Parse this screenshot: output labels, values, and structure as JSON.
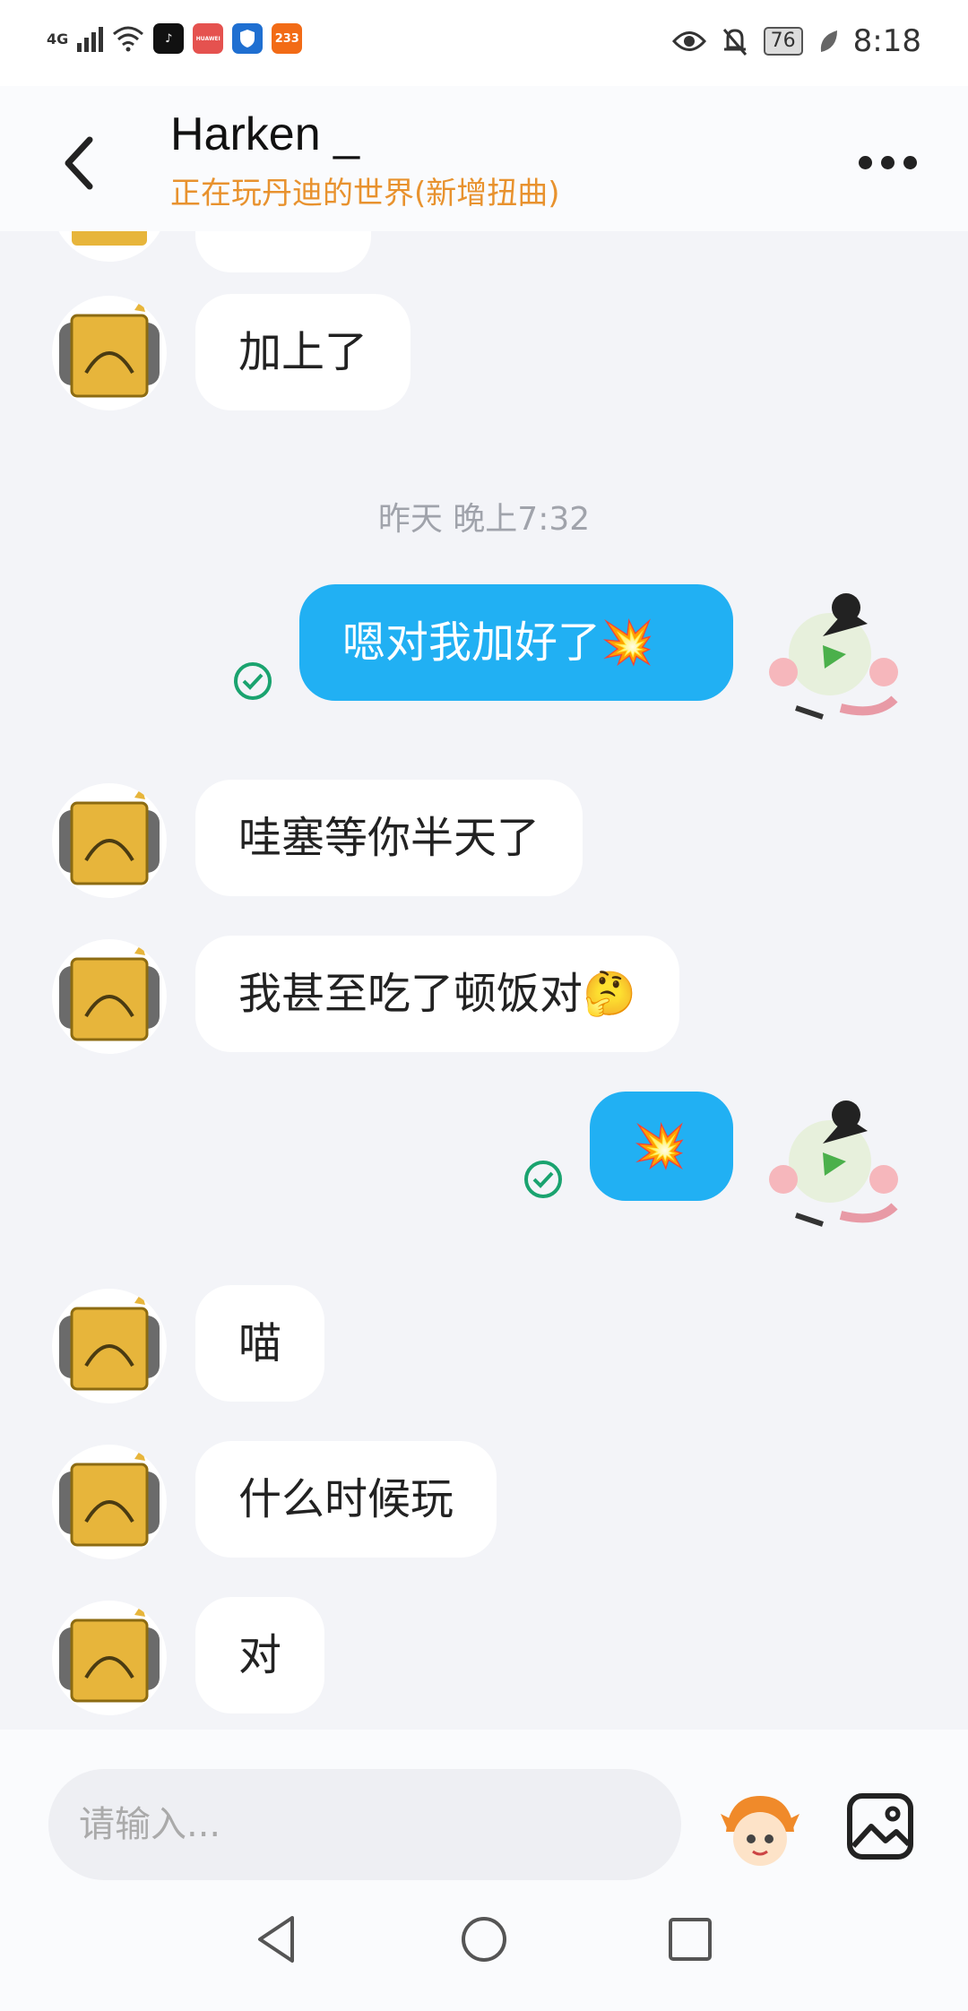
{
  "status_bar": {
    "network": "4G",
    "time": "8:18",
    "battery": "76",
    "apps": [
      {
        "name": "tiktok-icon",
        "label": "♪",
        "color": "#111111"
      },
      {
        "name": "huawei-icon",
        "label": "HUAWEI",
        "color": "#e5524f"
      },
      {
        "name": "shield-app-icon",
        "label": "",
        "color": "#1f6fd1"
      },
      {
        "name": "app-233-icon",
        "label": "233",
        "color": "#f26b16"
      }
    ]
  },
  "header": {
    "title": "Harken _",
    "subtitle": "正在玩丹迪的世界(新增扭曲)"
  },
  "messages": [
    {
      "side": "left",
      "text": "加上了"
    },
    {
      "type": "timestamp",
      "text": "昨天 晚上7:32"
    },
    {
      "side": "right",
      "text": "嗯对我加好了💥",
      "status": "sent"
    },
    {
      "side": "left",
      "text": "哇塞等你半天了"
    },
    {
      "side": "left",
      "text": "我甚至吃了顿饭对🤔"
    },
    {
      "side": "right",
      "text": "💥",
      "status": "sent"
    },
    {
      "side": "left",
      "text": "喵"
    },
    {
      "side": "left",
      "text": "什么时候玩"
    },
    {
      "side": "left",
      "text": "对"
    }
  ],
  "input": {
    "placeholder": "请输入..."
  },
  "colors": {
    "accent": "#21b0f3",
    "subtitle": "#e8922e",
    "check": "#1aa36f"
  }
}
